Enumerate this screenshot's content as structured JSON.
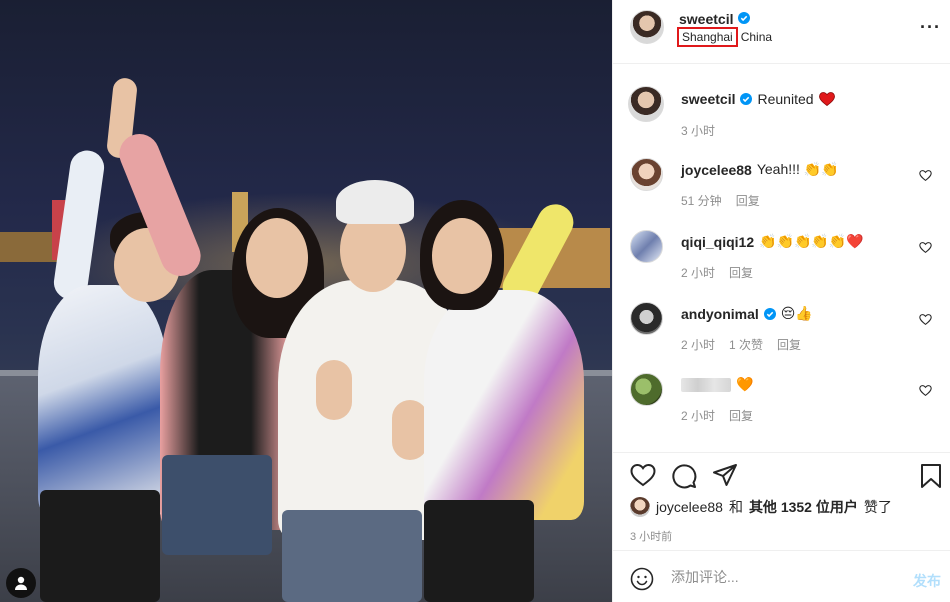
{
  "post": {
    "author": "sweetcil",
    "location_city": "Shanghai",
    "location_country": "China",
    "caption_text": "Reunited",
    "caption_time": "3 小时",
    "accent_color": "#0095f6",
    "highlight_color": "#e0191b"
  },
  "comments": [
    {
      "username": "joycelee88",
      "text": "Yeah!!! 👏👏",
      "time": "51 分钟",
      "reply": "回复",
      "likes": ""
    },
    {
      "username": "qiqi_qiqi12",
      "text": "👏👏👏👏👏❤️",
      "time": "2 小时",
      "reply": "回复",
      "likes": ""
    },
    {
      "username": "andyonimal",
      "text": "😔👍",
      "time": "2 小时",
      "likes": "1 次赞",
      "reply": "回复"
    },
    {
      "username": "",
      "text": "🧡",
      "time": "2 小时",
      "reply": "回复",
      "likes": ""
    }
  ],
  "likes_line": {
    "user": "joycelee88",
    "and": "和",
    "others": "其他 1352 位用户",
    "liked": "赞了"
  },
  "time_ago": "3 小时前",
  "add_comment": {
    "placeholder": "添加评论...",
    "post_label": "发布"
  }
}
